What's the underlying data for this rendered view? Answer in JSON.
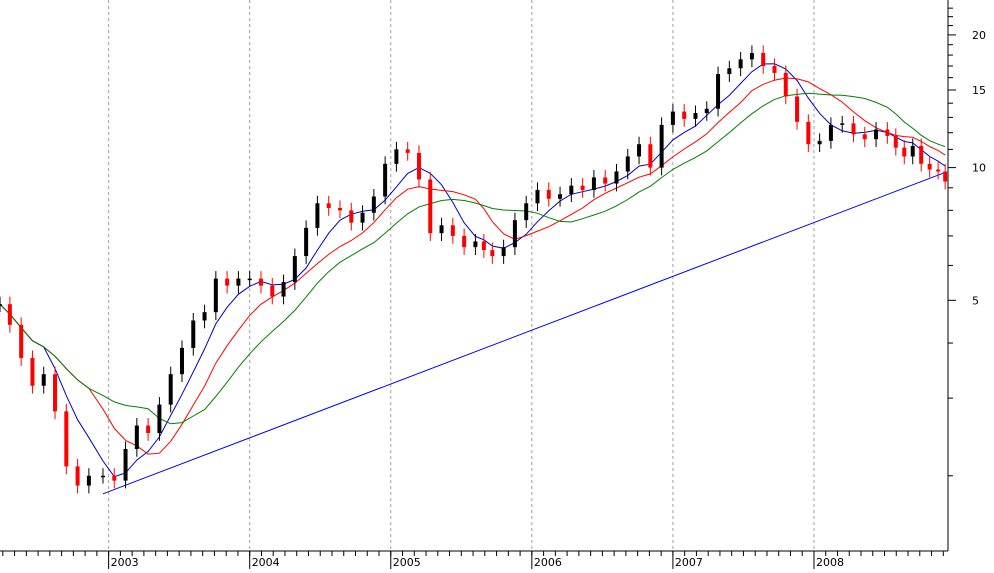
{
  "chart_data": {
    "type": "line",
    "title": "",
    "xlabel": "",
    "ylabel": "",
    "scale": "log",
    "ylim": [
      1.35,
      24
    ],
    "xlim": [
      2002.23,
      2008.95
    ],
    "grid": "vertical dashed at year boundaries",
    "legend": "none",
    "x_ticks": [
      {
        "value": 2003,
        "label": "2003"
      },
      {
        "value": 2004,
        "label": "2004"
      },
      {
        "value": 2005,
        "label": "2005"
      },
      {
        "value": 2006,
        "label": "2006"
      },
      {
        "value": 2007,
        "label": "2007"
      },
      {
        "value": 2008,
        "label": "2008"
      }
    ],
    "y_ticks": [
      {
        "value": 20,
        "label": "20"
      },
      {
        "value": 15,
        "label": "15"
      },
      {
        "value": 10,
        "label": "10"
      },
      {
        "value": 5,
        "label": "5"
      }
    ],
    "series": [
      {
        "key": "price",
        "style": "candlestick",
        "color_up": "#000000",
        "color_down": "#ff0000",
        "x": [
          2002.23,
          2002.3,
          2002.38,
          2002.46,
          2002.54,
          2002.62,
          2002.7,
          2002.78,
          2002.86,
          2002.96,
          2003.04,
          2003.12,
          2003.2,
          2003.28,
          2003.36,
          2003.44,
          2003.52,
          2003.6,
          2003.68,
          2003.76,
          2003.84,
          2003.92,
          2004.0,
          2004.08,
          2004.16,
          2004.24,
          2004.32,
          2004.4,
          2004.48,
          2004.56,
          2004.64,
          2004.72,
          2004.8,
          2004.88,
          2004.96,
          2005.04,
          2005.12,
          2005.2,
          2005.28,
          2005.36,
          2005.44,
          2005.52,
          2005.6,
          2005.66,
          2005.72,
          2005.8,
          2005.88,
          2005.96,
          2006.04,
          2006.12,
          2006.2,
          2006.28,
          2006.36,
          2006.44,
          2006.52,
          2006.6,
          2006.68,
          2006.76,
          2006.84,
          2006.92,
          2007.0,
          2007.08,
          2007.16,
          2007.24,
          2007.32,
          2007.4,
          2007.48,
          2007.56,
          2007.64,
          2007.72,
          2007.8,
          2007.88,
          2007.96,
          2008.04,
          2008.12,
          2008.2,
          2008.28,
          2008.36,
          2008.44,
          2008.52,
          2008.58,
          2008.64,
          2008.7,
          2008.76,
          2008.82,
          2008.88,
          2008.93
        ],
        "y": [
          4.9,
          4.4,
          3.7,
          3.2,
          3.4,
          2.8,
          2.1,
          1.9,
          2.0,
          2.0,
          1.95,
          2.3,
          2.6,
          2.5,
          2.9,
          3.4,
          3.9,
          4.5,
          4.7,
          5.6,
          5.4,
          5.6,
          5.6,
          5.4,
          5.1,
          5.5,
          6.3,
          7.3,
          8.3,
          8.1,
          8.0,
          7.5,
          7.9,
          8.6,
          10.2,
          11.0,
          10.8,
          9.4,
          7.1,
          7.4,
          7.0,
          6.6,
          6.8,
          6.5,
          6.3,
          6.6,
          7.6,
          8.3,
          8.9,
          8.5,
          8.7,
          9.1,
          8.9,
          9.5,
          9.2,
          9.8,
          10.6,
          11.3,
          10.0,
          12.5,
          13.4,
          12.9,
          13.3,
          13.6,
          16.3,
          16.8,
          17.6,
          18.2,
          17.0,
          16.4,
          14.5,
          12.7,
          11.3,
          11.5,
          12.5,
          12.6,
          11.9,
          11.6,
          12.2,
          11.8,
          11.1,
          10.6,
          11.2,
          10.2,
          9.9,
          9.8,
          9.3
        ]
      },
      {
        "key": "ma_short",
        "color": "#0000cc",
        "period": 5
      },
      {
        "key": "ma_medium",
        "color": "#ff0000",
        "period": 9
      },
      {
        "key": "ma_long",
        "color": "#008000",
        "period": 14
      }
    ],
    "trendline": {
      "color": "#0000ff",
      "points": [
        [
          2002.96,
          1.82
        ],
        [
          2008.93,
          9.75
        ]
      ]
    }
  }
}
